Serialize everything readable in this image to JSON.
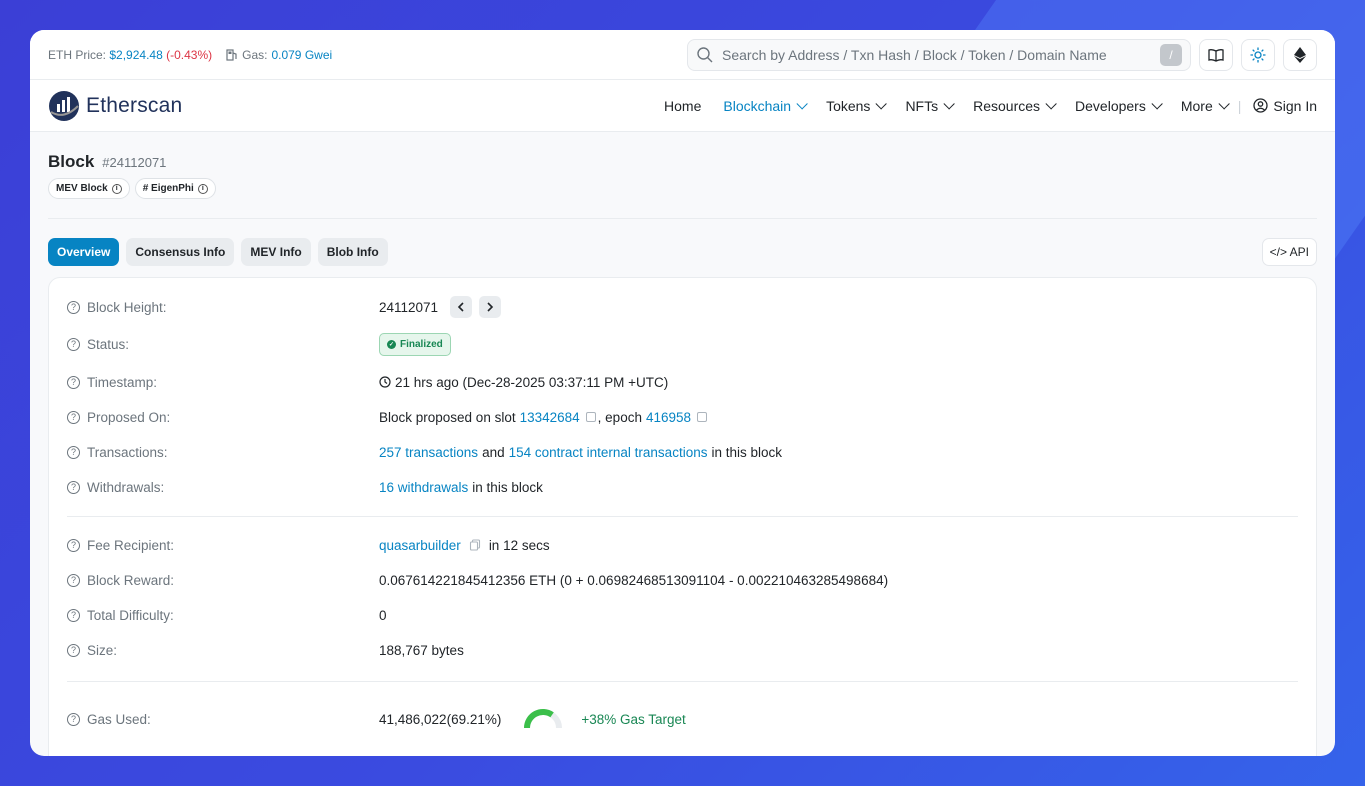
{
  "topbar": {
    "eth_price_label": "ETH Price:",
    "eth_price": "$2,924.48",
    "eth_change": "(-0.43%)",
    "gas_label": "Gas:",
    "gas_value": "0.079 Gwei",
    "search_placeholder": "Search by Address / Txn Hash / Block / Token / Domain Name",
    "search_shortcut": "/"
  },
  "nav": {
    "logo": "Etherscan",
    "items": [
      "Home",
      "Blockchain",
      "Tokens",
      "NFTs",
      "Resources",
      "Developers",
      "More"
    ],
    "signin": "Sign In"
  },
  "header": {
    "title": "Block",
    "block_number": "#24112071",
    "badges": [
      "MEV Block",
      "# EigenPhi"
    ]
  },
  "tabs": [
    "Overview",
    "Consensus Info",
    "MEV Info",
    "Blob Info"
  ],
  "api_label": "</> API",
  "details": {
    "block_height_label": "Block Height:",
    "block_height": "24112071",
    "status_label": "Status:",
    "status": "Finalized",
    "timestamp_label": "Timestamp:",
    "timestamp": "21 hrs ago (Dec-28-2025 03:37:11 PM +UTC)",
    "proposed_label": "Proposed On:",
    "proposed_prefix": "Block proposed on slot",
    "slot": "13342684",
    "epoch_prefix": ", epoch",
    "epoch": "416958",
    "transactions_label": "Transactions:",
    "tx_link": "257 transactions",
    "tx_and": "and",
    "internal_link": "154 contract internal transactions",
    "tx_suffix": "in this block",
    "withdrawals_label": "Withdrawals:",
    "withdrawals_link": "16 withdrawals",
    "withdrawals_suffix": "in this block",
    "fee_recipient_label": "Fee Recipient:",
    "fee_recipient": "quasarbuilder",
    "fee_recipient_suffix": "in 12 secs",
    "block_reward_label": "Block Reward:",
    "block_reward": "0.067614221845412356 ETH (0 + 0.06982468513091104 - 0.002210463285498684)",
    "difficulty_label": "Total Difficulty:",
    "difficulty": "0",
    "size_label": "Size:",
    "size": "188,767 bytes",
    "gas_used_label": "Gas Used:",
    "gas_used": "41,486,022",
    "gas_used_pct": "(69.21%)",
    "gas_used_fraction": 0.6921,
    "gas_target": "+38% Gas Target"
  },
  "colors": {
    "accent": "#0784c3",
    "negative": "#dc3545",
    "success": "#198754"
  }
}
